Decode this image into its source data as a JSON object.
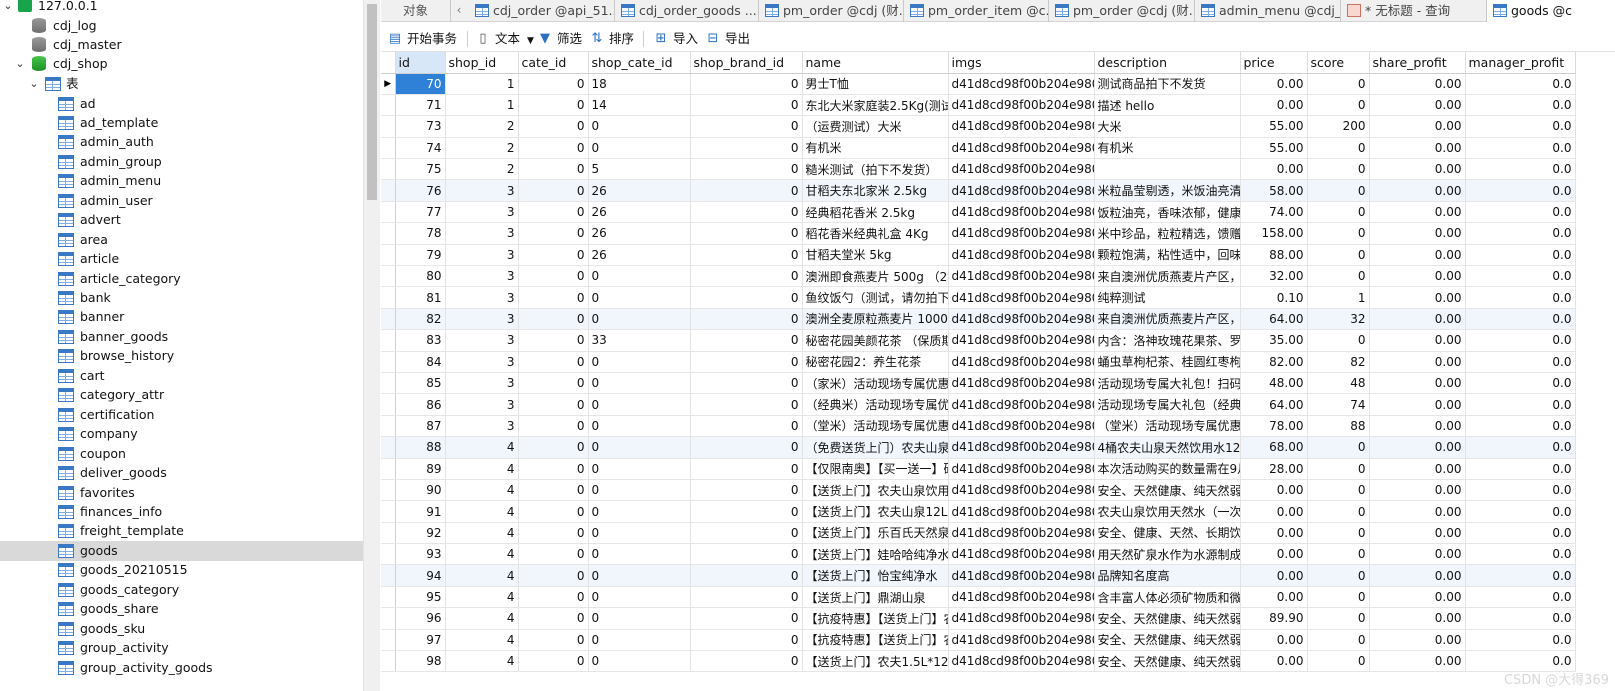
{
  "tree": {
    "connection": "127.0.0.1",
    "databases": [
      "cdj_log",
      "cdj_master",
      "cdj_shop"
    ],
    "tables_folder": "表",
    "tables": [
      "ad",
      "ad_template",
      "admin_auth",
      "admin_group",
      "admin_menu",
      "admin_user",
      "advert",
      "area",
      "article",
      "article_category",
      "bank",
      "banner",
      "banner_goods",
      "browse_history",
      "cart",
      "category_attr",
      "certification",
      "company",
      "coupon",
      "deliver_goods",
      "favorites",
      "finances_info",
      "freight_template",
      "goods",
      "goods_20210515",
      "goods_category",
      "goods_share",
      "goods_sku",
      "group_activity",
      "group_activity_goods"
    ],
    "selected_table": "goods"
  },
  "tabs": {
    "objects": "对象",
    "items": [
      "cdj_order @api_51...",
      "cdj_order_goods ...",
      "pm_order @cdj (财...",
      "pm_order_item @c...",
      "pm_order @cdj (财...",
      "admin_menu @cdj_...",
      "* 无标题 - 查询",
      "goods @c"
    ]
  },
  "toolbar": {
    "begin_transaction": "开始事务",
    "text": "文本",
    "filter": "筛选",
    "sort": "排序",
    "import": "导入",
    "export": "导出"
  },
  "grid": {
    "columns": [
      "id",
      "shop_id",
      "cate_id",
      "shop_cate_id",
      "shop_brand_id",
      "name",
      "imgs",
      "description",
      "price",
      "score",
      "share_profit",
      "manager_profit"
    ],
    "rows": [
      [
        "70",
        "1",
        "0",
        "18",
        "0",
        "男士T恤",
        "d41d8cd98f00b204e9800",
        "测试商品拍下不发货",
        "0.00",
        "0",
        "0.00",
        "0.0"
      ],
      [
        "71",
        "1",
        "0",
        "14",
        "0",
        "东北大米家庭装2.5Kg(测试,",
        "d41d8cd98f00b204e9800",
        "描述 hello",
        "0.00",
        "0",
        "0.00",
        "0.0"
      ],
      [
        "73",
        "2",
        "0",
        "0",
        "0",
        "（运费测试）大米",
        "d41d8cd98f00b204e9800",
        "大米",
        "55.00",
        "200",
        "0.00",
        "0.0"
      ],
      [
        "74",
        "2",
        "0",
        "0",
        "0",
        "有机米",
        "d41d8cd98f00b204e9800",
        "有机米",
        "55.00",
        "0",
        "0.00",
        "0.0"
      ],
      [
        "75",
        "2",
        "0",
        "5",
        "0",
        "糙米测试（拍下不发货）",
        "d41d8cd98f00b204e9800",
        "",
        "0.00",
        "0",
        "0.00",
        "0.0"
      ],
      [
        "76",
        "3",
        "0",
        "26",
        "0",
        "甘稻夫东北家米 2.5kg",
        "d41d8cd98f00b204e9800",
        "米粒晶莹剔透，米饭油亮清香",
        "58.00",
        "0",
        "0.00",
        "0.0"
      ],
      [
        "77",
        "3",
        "0",
        "26",
        "0",
        "经典稻花香米 2.5kg",
        "d41d8cd98f00b204e9800",
        "饭粒油亮，香味浓郁，健康美味",
        "74.00",
        "0",
        "0.00",
        "0.0"
      ],
      [
        "78",
        "3",
        "0",
        "26",
        "0",
        "稻花香米经典礼盒 4Kg",
        "d41d8cd98f00b204e9800",
        "米中珍品，粒粒精选，馈赠亲友",
        "158.00",
        "0",
        "0.00",
        "0.0"
      ],
      [
        "79",
        "3",
        "0",
        "26",
        "0",
        "甘稻夫堂米 5kg",
        "d41d8cd98f00b204e9800",
        "颗粒饱满，粘性适中，回味甘甜",
        "88.00",
        "0",
        "0.00",
        "0.0"
      ],
      [
        "80",
        "3",
        "0",
        "0",
        "0",
        "澳洲即食燕麦片 500g （2袋",
        "d41d8cd98f00b204e9800",
        "来自澳洲优质燕麦片产区，脂",
        "32.00",
        "0",
        "0.00",
        "0.0"
      ],
      [
        "81",
        "3",
        "0",
        "0",
        "0",
        "鱼纹饭勺（测试，请勿拍下）",
        "d41d8cd98f00b204e9800",
        "纯粹测试",
        "0.10",
        "1",
        "0.00",
        "0.0"
      ],
      [
        "82",
        "3",
        "0",
        "0",
        "0",
        "澳洲全麦原粒燕麦片 1000g",
        "d41d8cd98f00b204e9800",
        "来自澳洲优质燕麦片产区，脂",
        "64.00",
        "32",
        "0.00",
        "0.0"
      ],
      [
        "83",
        "3",
        "0",
        "33",
        "0",
        "秘密花园美颜花茶 （保质期",
        "d41d8cd98f00b204e9800",
        "内含：洛神玫瑰花果茶、罗汉",
        "35.00",
        "0",
        "0.00",
        "0.0"
      ],
      [
        "84",
        "3",
        "0",
        "0",
        "0",
        "秘密花园2：养生花茶",
        "d41d8cd98f00b204e9800",
        "蛹虫草枸杞茶、桂圆红枣枸杞",
        "82.00",
        "82",
        "0.00",
        "0.0"
      ],
      [
        "85",
        "3",
        "0",
        "0",
        "0",
        "（家米）活动现场专属优惠福",
        "d41d8cd98f00b204e9800",
        "活动现场专属大礼包！扫码进",
        "48.00",
        "48",
        "0.00",
        "0.0"
      ],
      [
        "86",
        "3",
        "0",
        "0",
        "0",
        "（经典米）活动现场专属优惠",
        "d41d8cd98f00b204e9800",
        "活动现场专属大礼包（经典米",
        "64.00",
        "74",
        "0.00",
        "0.0"
      ],
      [
        "87",
        "3",
        "0",
        "0",
        "0",
        "（堂米）活动现场专属优惠福",
        "d41d8cd98f00b204e9800",
        "（堂米）活动现场专属优惠福",
        "78.00",
        "88",
        "0.00",
        "0.0"
      ],
      [
        "88",
        "4",
        "0",
        "0",
        "0",
        "（免费送货上门）农夫山泉天",
        "d41d8cd98f00b204e9800",
        "4桶农夫山泉天然饮用水12L",
        "68.00",
        "0",
        "0.00",
        "0.0"
      ],
      [
        "89",
        "4",
        "0",
        "0",
        "0",
        "【仅限南奥】【买一送一】矿",
        "d41d8cd98f00b204e9800",
        "本次活动购买的数量需在9月",
        "28.00",
        "0",
        "0.00",
        "0.0"
      ],
      [
        "90",
        "4",
        "0",
        "0",
        "0",
        "【送货上门】农夫山泉饮用天",
        "d41d8cd98f00b204e9800",
        "安全、天然健康、纯天然弱碱",
        "0.00",
        "0",
        "0.00",
        "0.0"
      ],
      [
        "91",
        "4",
        "0",
        "0",
        "0",
        "【送货上门】农夫山泉12L ·",
        "d41d8cd98f00b204e9800",
        "农夫山泉饮用天然水（一次性",
        "0.00",
        "0",
        "0.00",
        "0.0"
      ],
      [
        "92",
        "4",
        "0",
        "0",
        "0",
        "【送货上门】乐百氏天然泉水",
        "d41d8cd98f00b204e9800",
        "安全、健康、天然、长期饮用",
        "0.00",
        "0",
        "0.00",
        "0.0"
      ],
      [
        "93",
        "4",
        "0",
        "0",
        "0",
        "【送货上门】娃哈哈纯净水",
        "d41d8cd98f00b204e9800",
        "用天然矿泉水作为水源制成纯",
        "0.00",
        "0",
        "0.00",
        "0.0"
      ],
      [
        "94",
        "4",
        "0",
        "0",
        "0",
        "【送货上门】怡宝纯净水",
        "d41d8cd98f00b204e9800",
        "品牌知名度高",
        "0.00",
        "0",
        "0.00",
        "0.0"
      ],
      [
        "95",
        "4",
        "0",
        "0",
        "0",
        "【送货上门】鼎湖山泉",
        "d41d8cd98f00b204e9800",
        "含丰富人体必须矿物质和微量",
        "0.00",
        "0",
        "0.00",
        "0.0"
      ],
      [
        "96",
        "4",
        "0",
        "0",
        "0",
        "【抗疫特惠】【送货上门】农",
        "d41d8cd98f00b204e9800",
        "安全、天然健康、纯天然弱碱",
        "89.90",
        "0",
        "0.00",
        "0.0"
      ],
      [
        "97",
        "4",
        "0",
        "0",
        "0",
        "【抗疫特惠】【送货上门】农",
        "d41d8cd98f00b204e9800",
        "安全、天然健康、纯天然弱碱",
        "0.00",
        "0",
        "0.00",
        "0.0"
      ],
      [
        "98",
        "4",
        "0",
        "0",
        "0",
        "【送货上门】农夫1.5L*12支",
        "d41d8cd98f00b204e9800",
        "安全、天然健康、纯天然弱碱",
        "0.00",
        "0",
        "0.00",
        "0.0"
      ]
    ]
  },
  "watermark": "CSDN @大得369"
}
